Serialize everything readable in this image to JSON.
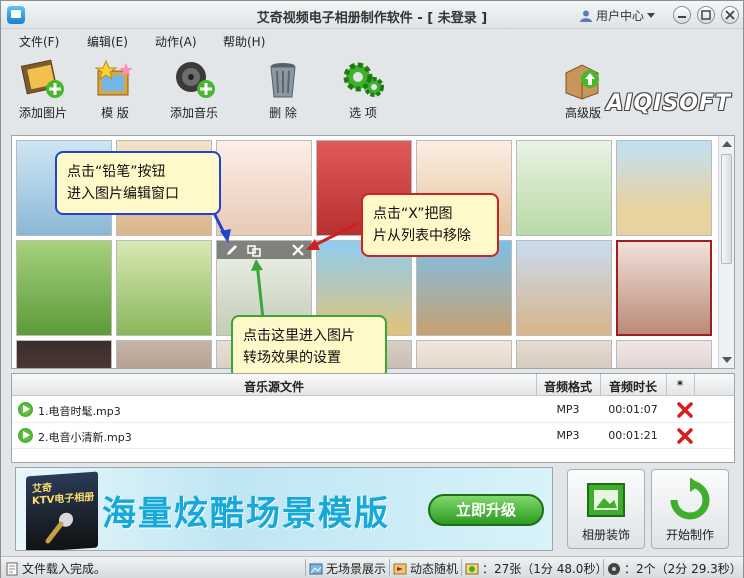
{
  "window": {
    "title": "艾奇视频电子相册制作软件 - [ 未登录 ]",
    "user_center": "用户中心"
  },
  "menu": [
    "文件(F)",
    "编辑(E)",
    "动作(A)",
    "帮助(H)"
  ],
  "toolbar": {
    "add_photo": "添加图片",
    "template": "模 版",
    "add_music": "添加音乐",
    "delete": "删 除",
    "options": "选 项",
    "premium": "高级版",
    "logo": "AIQISOFT"
  },
  "callouts": {
    "pencil": "点击“铅笔”按钮\n进入图片编辑窗口",
    "x_remove": "点击“X”把图\n片从列表中移除",
    "transition": "点击这里进入图片\n转场效果的设置"
  },
  "music": {
    "headers": {
      "source": "音乐源文件",
      "format": "音频格式",
      "duration": "音频时长",
      "star": "*"
    },
    "rows": [
      {
        "name": "1.电音时髦.mp3",
        "format": "MP3",
        "duration": "00:01:07"
      },
      {
        "name": "2.电音小清新.mp3",
        "format": "MP3",
        "duration": "00:01:21"
      }
    ]
  },
  "banner": {
    "box_title": "艾奇\nKTV电子相册",
    "slogan": "海量炫酷场景模版",
    "upgrade": "立即升级"
  },
  "buttons": {
    "decorate": "相册装饰",
    "start": "开始制作"
  },
  "status": {
    "load": "文件载入完成。",
    "scene": "无场景展示",
    "dynamic": "动态随机",
    "photos": "：27张（1分 48.0秒）",
    "music": "：2个（2分 29.3秒）"
  },
  "colors": {
    "accent_blue": "#2244cc",
    "accent_red": "#cc2222",
    "accent_green": "#3aa53a",
    "banner_text": "#16a8d8"
  }
}
